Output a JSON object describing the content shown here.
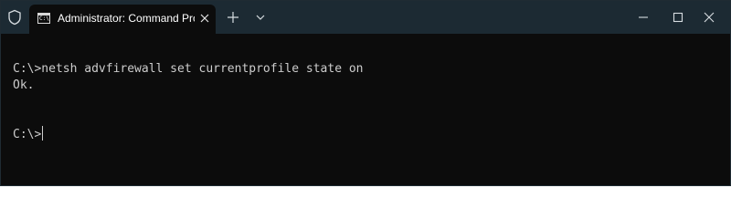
{
  "window": {
    "tab_title": "Administrator: Command Promp",
    "tab_icon_text": "C:\\"
  },
  "icons": {
    "security": "shield-icon",
    "tab": "command-prompt-icon",
    "tab_close": "close-icon",
    "new_tab": "plus-icon",
    "dropdown": "chevron-down-icon",
    "minimize": "minimize-icon",
    "maximize": "maximize-icon",
    "close": "close-icon"
  },
  "colors": {
    "titlebar": "#1c2a33",
    "terminal_background": "#0c0c0c",
    "terminal_text": "#cccccc"
  },
  "terminal": {
    "lines": [
      "C:\\>netsh advfirewall set currentprofile state on",
      "Ok.",
      ""
    ],
    "prompt": "C:\\>"
  }
}
